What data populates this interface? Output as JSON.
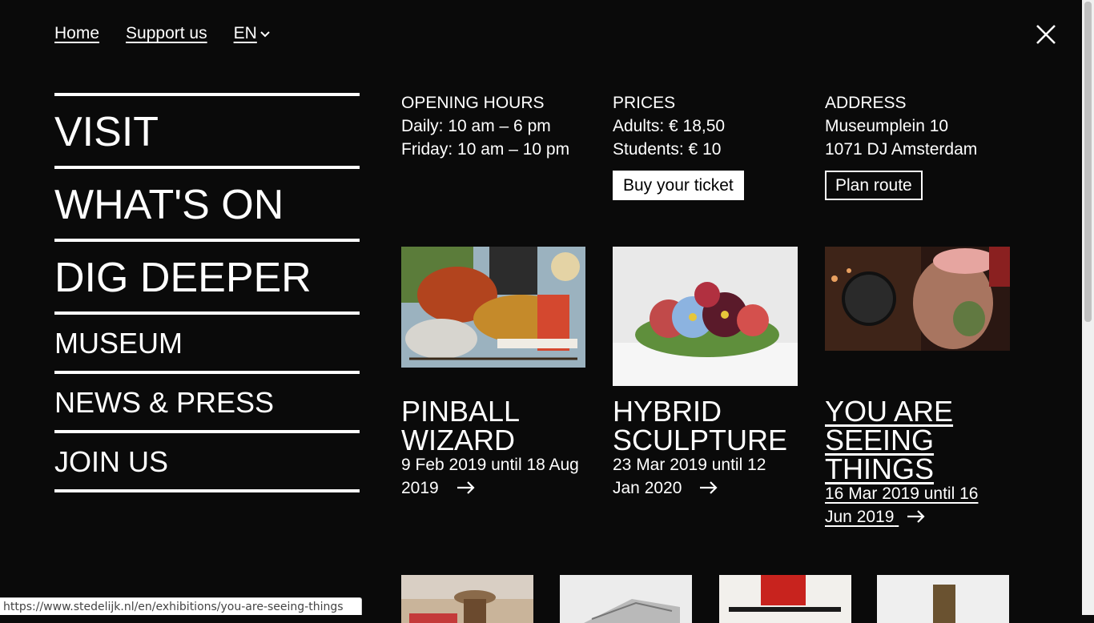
{
  "topnav": {
    "home": "Home",
    "support": "Support us",
    "language": "EN"
  },
  "menu": {
    "items": [
      {
        "label": "VISIT"
      },
      {
        "label": "WHAT'S ON"
      },
      {
        "label": "DIG DEEPER"
      },
      {
        "label": "MUSEUM"
      },
      {
        "label": "NEWS & PRESS"
      },
      {
        "label": "JOIN US"
      }
    ]
  },
  "info": {
    "hours": {
      "title": "OPENING HOURS",
      "line1": "Daily: 10 am – 6 pm",
      "line2": "Friday: 10 am – 10 pm"
    },
    "prices": {
      "title": "PRICES",
      "line1": "Adults: € 18,50",
      "line2": "Students: € 10",
      "button": "Buy your ticket"
    },
    "address": {
      "title": "ADDRESS",
      "line1": "Museumplein 10",
      "line2": "1071 DJ Amsterdam",
      "button": "Plan route"
    }
  },
  "exhibitions": [
    {
      "title_l1": "PINBALL",
      "title_l2": "WIZARD",
      "dates_l1": "9 Feb 2019 until 18 Aug",
      "dates_l2": "2019"
    },
    {
      "title_l1": "HYBRID",
      "title_l2": "SCULPTURE",
      "dates_l1": "23 Mar 2019 until 12",
      "dates_l2": "Jan 2020"
    },
    {
      "title_l1": "YOU ARE",
      "title_l2": "SEEING",
      "title_l3": "THINGS",
      "dates_l1": "16 Mar 2019 until 16",
      "dates_l2": "Jun 2019"
    }
  ],
  "status_url": "https://www.stedelijk.nl/en/exhibitions/you-are-seeing-things",
  "colors": {
    "background": "#0a0a0a",
    "text": "#ffffff"
  }
}
